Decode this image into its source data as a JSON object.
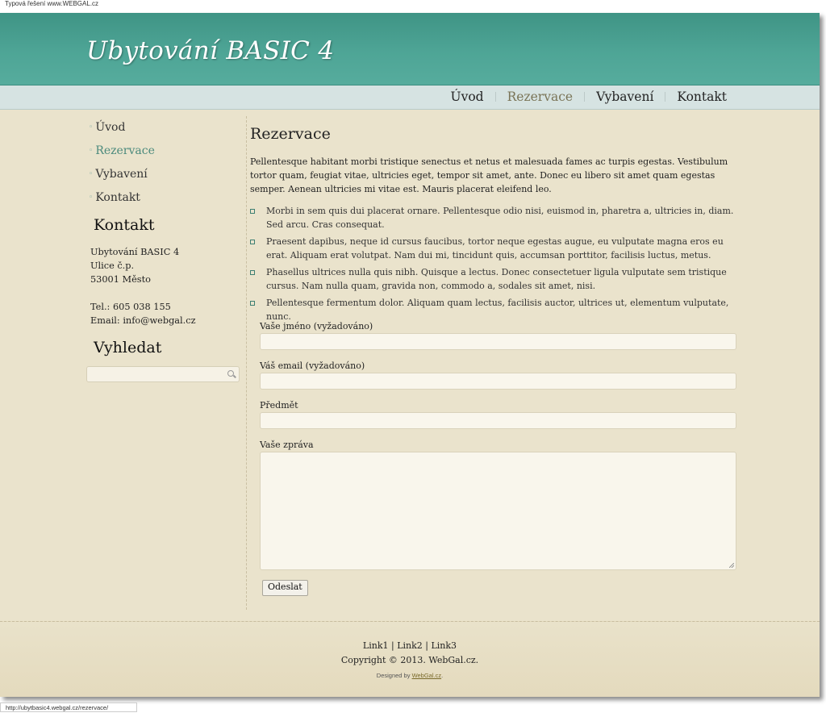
{
  "top_note": "Typová řešení www.WEBGAL.cz",
  "header": {
    "title": "Ubytování BASIC 4"
  },
  "nav": {
    "items": [
      {
        "label": "Úvod",
        "active": false
      },
      {
        "label": "Rezervace",
        "active": true
      },
      {
        "label": "Vybavení",
        "active": false
      },
      {
        "label": "Kontakt",
        "active": false
      }
    ]
  },
  "sidebar": {
    "menu": [
      {
        "label": "Úvod"
      },
      {
        "label": "Rezervace",
        "active": true
      },
      {
        "label": "Vybavení"
      },
      {
        "label": "Kontakt"
      }
    ],
    "contact": {
      "heading": "Kontakt",
      "name": "Ubytování BASIC 4",
      "street": "Ulice č.p.",
      "city": "53001 Město",
      "phone": "Tel.: 605 038 155",
      "email": "Email: info@webgal.cz"
    },
    "search": {
      "heading": "Vyhledat",
      "value": ""
    }
  },
  "main": {
    "title": "Rezervace",
    "intro": "Pellentesque habitant morbi tristique senectus et netus et malesuada fames ac turpis egestas. Vestibulum tortor quam, feugiat vitae, ultricies eget, tempor sit amet, ante. Donec eu libero sit amet quam egestas semper. Aenean ultricies mi vitae est. Mauris placerat eleifend leo.",
    "list": [
      "Morbi in sem quis dui placerat ornare. Pellentesque odio nisi, euismod in, pharetra a, ultricies in, diam. Sed arcu. Cras consequat.",
      "Praesent dapibus, neque id cursus faucibus, tortor neque egestas augue, eu vulputate magna eros eu erat. Aliquam erat volutpat. Nam dui mi, tincidunt quis, accumsan porttitor, facilisis luctus, metus.",
      "Phasellus ultrices nulla quis nibh. Quisque a lectus. Donec consectetuer ligula vulputate sem tristique cursus. Nam nulla quam, gravida non, commodo a, sodales sit amet, nisi.",
      "Pellentesque fermentum dolor. Aliquam quam lectus, facilisis auctor, ultrices ut, elementum vulputate, nunc."
    ],
    "form": {
      "name_label": "Vaše jméno (vyžadováno)",
      "name_value": "",
      "email_label": "Váš email (vyžadováno)",
      "email_value": "",
      "subject_label": "Předmět",
      "subject_value": "",
      "message_label": "Vaše zpráva",
      "message_value": "",
      "submit_label": "Odeslat"
    }
  },
  "footer": {
    "links": [
      "Link1",
      "Link2",
      "Link3"
    ],
    "link_sep": " | ",
    "copyright": "Copyright © 2013. WebGal.cz.",
    "designed_prefix": "Designed by ",
    "designed_link": "WebGal.cz",
    "designed_suffix": "."
  },
  "status_url": "http://ubytbasic4.webgal.cz/rezervace/",
  "colors": {
    "header_teal": "#4ea596",
    "navbar": "#d6e3e2",
    "page_bg": "#eae3cc",
    "active_nav": "#7a7457",
    "active_side": "#4b8a7c"
  }
}
